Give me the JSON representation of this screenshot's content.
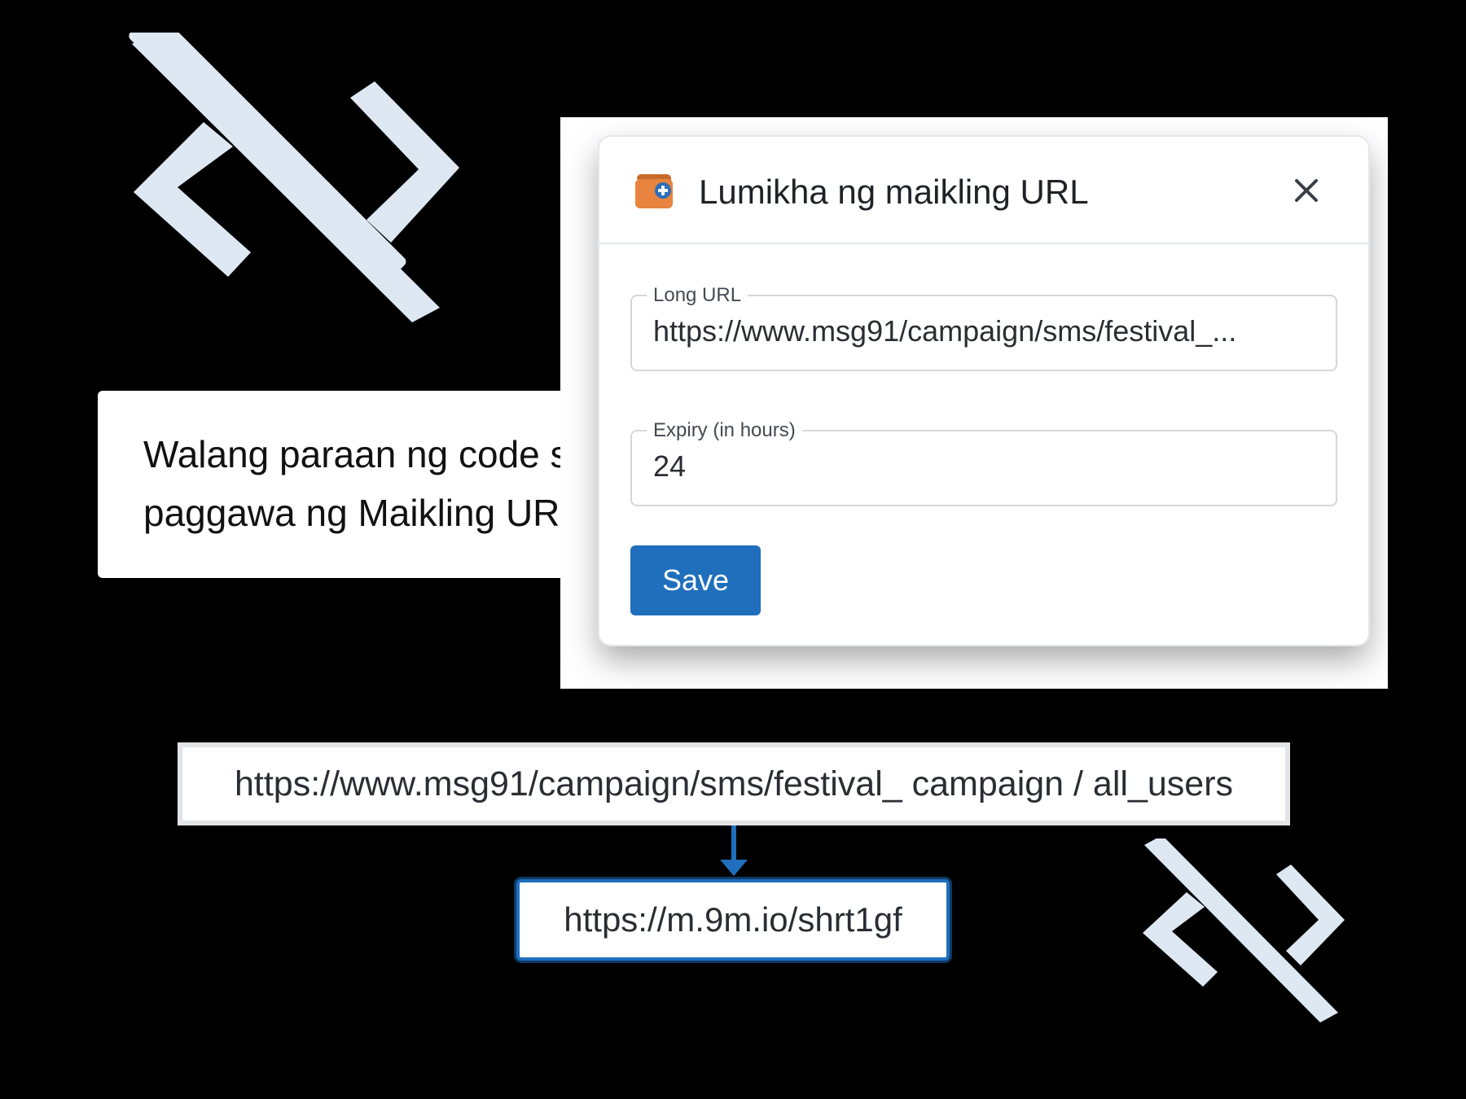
{
  "tagline": {
    "line1": "Walang paraan ng code s",
    "line2": "paggawa ng Maikling UR"
  },
  "dialog": {
    "title": "Lumikha ng maikling URL",
    "icon": "link-wallet-icon",
    "close_icon": "close-icon",
    "fields": {
      "long_url": {
        "label": "Long URL",
        "value": "https://www.msg91/campaign/sms/festival_..."
      },
      "expiry": {
        "label": "Expiry (in hours)",
        "value": "24"
      }
    },
    "save_label": "Save"
  },
  "example": {
    "long_url": "https://www.msg91/campaign/sms/festival_ campaign / all_users",
    "arrow_icon": "arrow-down-icon",
    "short_url": "https://m.9m.io/shrt1gf"
  },
  "colors": {
    "accent": "#1f6fbd",
    "decoration": "#dde8f3",
    "icon_orange": "#e8843f",
    "background": "#000000"
  }
}
